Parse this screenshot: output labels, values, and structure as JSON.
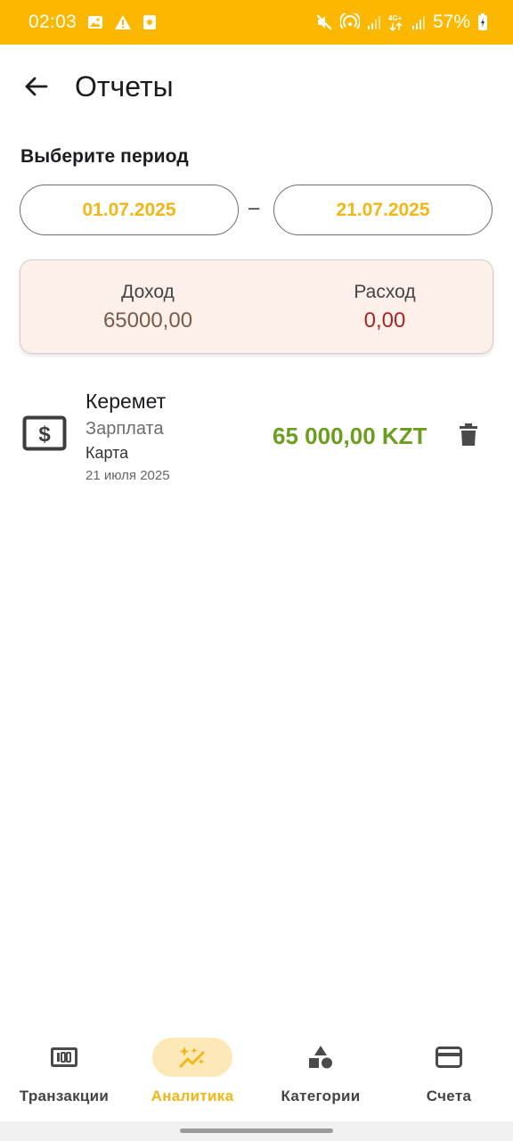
{
  "status_bar": {
    "time": "02:03",
    "battery": "57%",
    "icons_left": [
      "image-icon",
      "warning-icon",
      "app-notification-icon"
    ],
    "icons_right": [
      "mute-icon",
      "hotspot-icon",
      "signal-icon",
      "4g-signal-icon",
      "signal-icon-2",
      "battery-icon"
    ]
  },
  "app_bar": {
    "title": "Отчеты"
  },
  "period": {
    "label": "Выберите период",
    "start_date": "01.07.2025",
    "separator": "–",
    "end_date": "21.07.2025"
  },
  "summary": {
    "income_label": "Доход",
    "income_value": "65000,00",
    "expense_label": "Расход",
    "expense_value": "0,00"
  },
  "transactions": [
    {
      "title": "Керемет",
      "category": "Зарплата",
      "account": "Карта",
      "date": "21 июля 2025",
      "amount": "65 000,00 KZT",
      "icon": "money-icon"
    }
  ],
  "bottom_nav": {
    "items": [
      {
        "label": "Транзакции",
        "icon": "transactions-icon",
        "active": false
      },
      {
        "label": "Аналитика",
        "icon": "analytics-icon",
        "active": true
      },
      {
        "label": "Категории",
        "icon": "categories-icon",
        "active": false
      },
      {
        "label": "Счета",
        "icon": "card-icon",
        "active": false
      }
    ]
  },
  "colors": {
    "status_bar": "#fcb800",
    "accent": "#f3b616",
    "income": "#7a5a48",
    "expense": "#a3271f",
    "amount_positive": "#6b9e1e",
    "summary_bg": "#fdf0eb"
  }
}
